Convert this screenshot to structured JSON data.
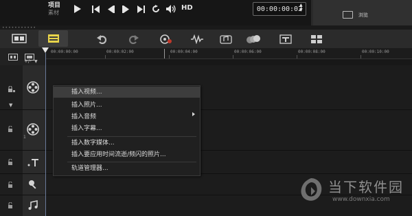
{
  "player": {
    "project_label": "项目",
    "clip_label": "素材",
    "timecode": "00:00:00:02",
    "hd_label": "HD",
    "browse_label": "浏览"
  },
  "ruler": {
    "ticks": [
      "00:00:00:00",
      "00:00:02:00",
      "00:00:04:00",
      "00:00:06:00",
      "00:00:08:00",
      "00:00:10:00"
    ],
    "zoom_label": "+/-"
  },
  "context_menu": {
    "items": [
      {
        "label": "插入视频...",
        "highlighted": true
      },
      {
        "label": "插入照片..."
      },
      {
        "label": "插入音频",
        "has_submenu": true
      },
      {
        "label": "插入字幕..."
      },
      {
        "label": "插入数字媒体..."
      },
      {
        "label": "插入要应用时间流逝/频闪的照片..."
      },
      {
        "label": "轨道管理器..."
      }
    ]
  },
  "tracks": [
    {
      "icon": "film-reel-icon"
    },
    {
      "icon": "film-reel-icon"
    },
    {
      "icon": "title-icon"
    },
    {
      "icon": "voice-icon"
    },
    {
      "icon": "music-icon"
    }
  ],
  "watermark": {
    "name": "当下软件园",
    "url": "www.downxia.com"
  },
  "colors": {
    "background": "#1a1a1a",
    "toolbar": "#2b2b2b",
    "menu_bg": "#202020",
    "menu_highlight": "#3d3d3d",
    "timeline_icon_active": "#e8d44a"
  }
}
